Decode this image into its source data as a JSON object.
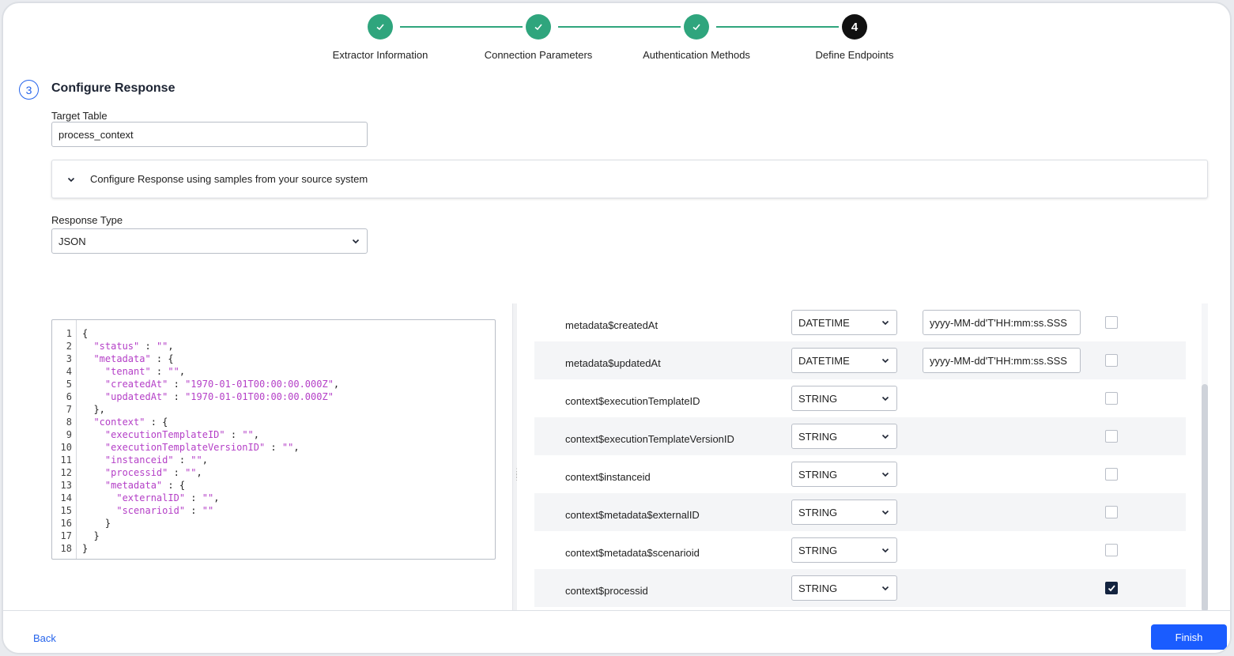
{
  "stepper": {
    "steps": [
      {
        "label": "Extractor Information",
        "state": "done"
      },
      {
        "label": "Connection Parameters",
        "state": "done"
      },
      {
        "label": "Authentication Methods",
        "state": "done"
      },
      {
        "label": "Define Endpoints",
        "state": "active",
        "number": "4"
      }
    ],
    "done_color": "#2fa57d",
    "active_color": "#111111"
  },
  "section": {
    "number": "3",
    "title": "Configure Response"
  },
  "target_table": {
    "label": "Target Table",
    "value": "process_context"
  },
  "accordion": {
    "label": "Configure Response using samples from your source system"
  },
  "response_type": {
    "label": "Response Type",
    "value": "JSON"
  },
  "editor": {
    "lines": [
      [
        {
          "t": "{"
        }
      ],
      [
        {
          "t": "  "
        },
        {
          "t": "\"status\"",
          "k": 1
        },
        {
          "t": " : "
        },
        {
          "t": "\"\"",
          "k": 1
        },
        {
          "t": ","
        }
      ],
      [
        {
          "t": "  "
        },
        {
          "t": "\"metadata\"",
          "k": 1
        },
        {
          "t": " : {"
        }
      ],
      [
        {
          "t": "    "
        },
        {
          "t": "\"tenant\"",
          "k": 1
        },
        {
          "t": " : "
        },
        {
          "t": "\"\"",
          "k": 1
        },
        {
          "t": ","
        }
      ],
      [
        {
          "t": "    "
        },
        {
          "t": "\"createdAt\"",
          "k": 1
        },
        {
          "t": " : "
        },
        {
          "t": "\"1970-01-01T00:00:00.000Z\"",
          "k": 1
        },
        {
          "t": ","
        }
      ],
      [
        {
          "t": "    "
        },
        {
          "t": "\"updatedAt\"",
          "k": 1
        },
        {
          "t": " : "
        },
        {
          "t": "\"1970-01-01T00:00:00.000Z\"",
          "k": 1
        }
      ],
      [
        {
          "t": "  },"
        }
      ],
      [
        {
          "t": "  "
        },
        {
          "t": "\"context\"",
          "k": 1
        },
        {
          "t": " : {"
        }
      ],
      [
        {
          "t": "    "
        },
        {
          "t": "\"executionTemplateID\"",
          "k": 1
        },
        {
          "t": " : "
        },
        {
          "t": "\"\"",
          "k": 1
        },
        {
          "t": ","
        }
      ],
      [
        {
          "t": "    "
        },
        {
          "t": "\"executionTemplateVersionID\"",
          "k": 1
        },
        {
          "t": " : "
        },
        {
          "t": "\"\"",
          "k": 1
        },
        {
          "t": ","
        }
      ],
      [
        {
          "t": "    "
        },
        {
          "t": "\"instanceid\"",
          "k": 1
        },
        {
          "t": " : "
        },
        {
          "t": "\"\"",
          "k": 1
        },
        {
          "t": ","
        }
      ],
      [
        {
          "t": "    "
        },
        {
          "t": "\"processid\"",
          "k": 1
        },
        {
          "t": " : "
        },
        {
          "t": "\"\"",
          "k": 1
        },
        {
          "t": ","
        }
      ],
      [
        {
          "t": "    "
        },
        {
          "t": "\"metadata\"",
          "k": 1
        },
        {
          "t": " : {"
        }
      ],
      [
        {
          "t": "      "
        },
        {
          "t": "\"externalID\"",
          "k": 1
        },
        {
          "t": " : "
        },
        {
          "t": "\"\"",
          "k": 1
        },
        {
          "t": ","
        }
      ],
      [
        {
          "t": "      "
        },
        {
          "t": "\"scenarioid\"",
          "k": 1
        },
        {
          "t": " : "
        },
        {
          "t": "\"\"",
          "k": 1
        }
      ],
      [
        {
          "t": "    }"
        }
      ],
      [
        {
          "t": "  }"
        }
      ],
      [
        {
          "t": "}"
        }
      ]
    ]
  },
  "fields": [
    {
      "name": "metadata$createdAt",
      "type": "DATETIME",
      "format": "yyyy-MM-dd'T'HH:mm:ss.SSS",
      "checked": false
    },
    {
      "name": "metadata$updatedAt",
      "type": "DATETIME",
      "format": "yyyy-MM-dd'T'HH:mm:ss.SSS",
      "checked": false
    },
    {
      "name": "context$executionTemplateID",
      "type": "STRING",
      "format": null,
      "checked": false
    },
    {
      "name": "context$executionTemplateVersionID",
      "type": "STRING",
      "format": null,
      "checked": false
    },
    {
      "name": "context$instanceid",
      "type": "STRING",
      "format": null,
      "checked": false
    },
    {
      "name": "context$metadata$externalID",
      "type": "STRING",
      "format": null,
      "checked": false
    },
    {
      "name": "context$metadata$scenarioid",
      "type": "STRING",
      "format": null,
      "checked": false
    },
    {
      "name": "context$processid",
      "type": "STRING",
      "format": null,
      "checked": true
    }
  ],
  "footer": {
    "back_label": "Back",
    "finish_label": "Finish",
    "finish_color": "#1a5cff"
  }
}
